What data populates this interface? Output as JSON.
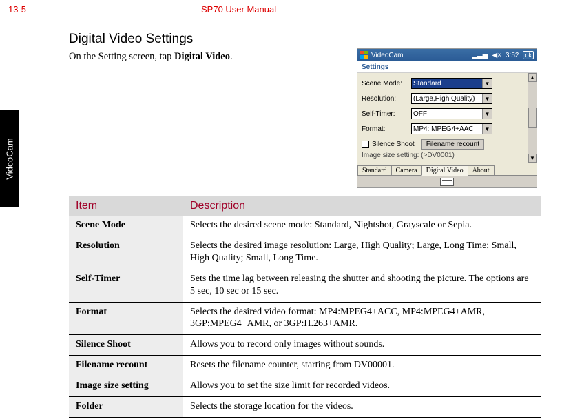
{
  "header": {
    "page_number": "13-5",
    "manual_title": "SP70 User Manual",
    "side_tab": "VideoCam"
  },
  "section": {
    "title": "Digital Video Settings",
    "intro_prefix": "On the Setting screen, tap ",
    "intro_bold": "Digital Video",
    "intro_suffix": "."
  },
  "screenshot": {
    "window_title": "VideoCam",
    "sub_header": "Settings",
    "status": {
      "signal": "▂▃▅",
      "sound": "◀×",
      "time": "3:52",
      "ok": "ok"
    },
    "fields": {
      "scene_mode": {
        "label": "Scene Mode:",
        "value": "Standard"
      },
      "resolution": {
        "label": "Resolution:",
        "value": "(Large,High Quality)"
      },
      "self_timer": {
        "label": "Self-Timer:",
        "value": "OFF"
      },
      "format": {
        "label": "Format:",
        "value": "MP4: MPEG4+AAC"
      },
      "silence_shoot_label": "Silence Shoot",
      "filename_recount_button": "Filename recount",
      "image_size_label": "Image size setting:",
      "image_size_value": "(>DV0001)"
    },
    "tabs": [
      "Standard",
      "Camera",
      "Digital Video",
      "About"
    ],
    "active_tab_index": 2
  },
  "table": {
    "headers": {
      "item": "Item",
      "description": "Description"
    },
    "rows": [
      {
        "item": "Scene Mode",
        "desc": "Selects the desired scene mode: Standard, Nightshot, Grayscale or Sepia."
      },
      {
        "item": "Resolution",
        "desc": "Selects the desired image resolution: Large, High Quality; Large, Long Time; Small, High Quality; Small, Long Time."
      },
      {
        "item": "Self-Timer",
        "desc": "Sets the time lag between releasing the shutter and shooting the picture. The options are 5 sec, 10 sec or 15 sec."
      },
      {
        "item": "Format",
        "desc": "Selects the desired video format: MP4:MPEG4+ACC, MP4:MPEG4+AMR, 3GP:MPEG4+AMR, or 3GP:H.263+AMR."
      },
      {
        "item": "Silence Shoot",
        "desc": "Allows you to record only images without sounds."
      },
      {
        "item": "Filename recount",
        "desc": "Resets the filename counter, starting from DV00001."
      },
      {
        "item": "Image size setting",
        "desc": "Allows you to set the size limit for recorded videos."
      },
      {
        "item": "Folder",
        "desc": "Selects the storage location for the videos."
      }
    ]
  }
}
